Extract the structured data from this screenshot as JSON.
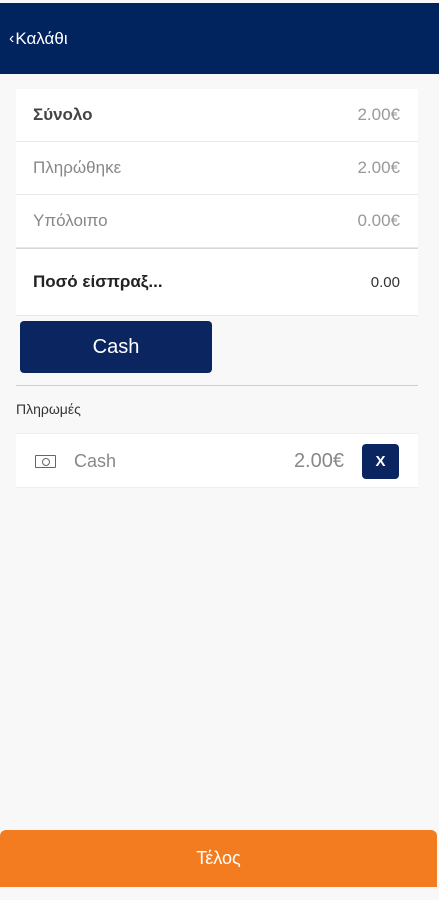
{
  "header": {
    "back_label": "Καλάθι",
    "back_icon": "chevron-left-icon",
    "background_color": "#01235e"
  },
  "summary": {
    "rows": [
      {
        "label": "Σύνολο",
        "value": "2.00€"
      },
      {
        "label": "Πληρώθηκε",
        "value": "2.00€"
      },
      {
        "label": "Υπόλοιπο",
        "value": "0.00€"
      }
    ],
    "amount_label": "Ποσό είσπραξ...",
    "amount_value": "0.00"
  },
  "actions": {
    "cash_button_label": "Cash"
  },
  "payments": {
    "title": "Πληρωμές",
    "items": [
      {
        "icon": "cash-icon",
        "method": "Cash",
        "amount": "2.00€",
        "remove_label": "X"
      }
    ]
  },
  "footer": {
    "finish_label": "Τέλος",
    "accent_color": "#f47c20"
  }
}
